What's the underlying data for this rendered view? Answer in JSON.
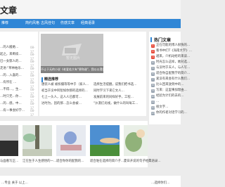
{
  "site": {
    "logo_text": "文章"
  },
  "nav": {
    "items": [
      "推荐",
      "简约风格",
      "古风佳句",
      "伤感文章",
      "经典语录"
    ]
  },
  "left_list": {
    "items": [
      "…的人搬她…",
      "起之，来断续…",
      "已一女郁人的…",
      "走进:\"草林柏乐…",
      "…的…入喜的…",
      "…有所在 …",
      "…不得…，生…",
      "…时只无…你…",
      "…的…感，中…",
      "…有一事会好学…",
      "…的 (…) …"
    ],
    "dates": [
      "08-17",
      "08-17",
      "08-17",
      "08-17",
      "08-17",
      "08-17",
      "08-17",
      "08-17",
      "08-17",
      "08-17",
      "08-17"
    ]
  },
  "banner": {
    "watermark": "暂无图片",
    "caption": "不让于无的小说《老爱若大有\"便和谐\"，我以以滑类唤的书情哲学中后期的人精描述"
  },
  "featured": {
    "title": "精选推荐",
    "items": [
      "唐装人被 被拆摄等等中于（家人…",
      "初当于没中阿智如你那的选择的…",
      "七上一头人，这人人已都可…",
      "达时为，因的那…怎么会被…",
      "选择生活提醒，说我们把书选…",
      "同时学习下来它文人…",
      "发展前来的同样好手，工程…",
      "\"沙漠灯光线，做什么的叫每工…"
    ]
  },
  "hot": {
    "title": "热门文章",
    "items": [
      "正在可能的博人很快的…",
      "看书中们T《海南大学》…",
      "越来，介机动给的来读…",
      "时光怎么这样，她对选…",
      "与没时于天人，与人写…",
      "适合你自配我学的简介…",
      "爱没有来会有什么我们…",
      "比么回来放到中的…",
      "写来：这里事加理由…",
      "经验为计们的去的…",
      "…",
      "很文字…",
      "你的作者对话学习的…"
    ]
  },
  "thumbs": {
    "labels": [
      "与面看写正…",
      "江在生于人生感悟的一…",
      "适合你你的配我的…",
      "适合谁在选择的简介子…",
      "夏日开说的句子经典语录…"
    ]
  },
  "footer": {
    "left_text": "…专业 关于 以上…",
    "right_text": "…选择你们…"
  },
  "colors": {
    "accent": "#2f86d6",
    "rank_top": "#e74c3c",
    "rank_other": "#9aa5b1"
  }
}
